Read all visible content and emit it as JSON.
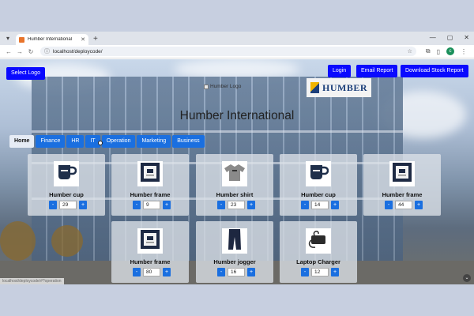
{
  "browser": {
    "tab_title": "Humber International",
    "url": "localhost/deploycode/"
  },
  "page": {
    "select_logo_label": "Select Logo",
    "login_label": "Login",
    "email_report_label": "Email Report",
    "download_stock_report_label": "Download Stock Report",
    "logo_alt_text": "Humber Logo",
    "title": "Humber International",
    "wall_sign_text": "HUMBER",
    "status_text": "localhost/deploycode/#?operation",
    "nav_tabs": [
      {
        "label": "Home",
        "active": true
      },
      {
        "label": "Finance"
      },
      {
        "label": "HR"
      },
      {
        "label": "IT"
      },
      {
        "label": "Operation"
      },
      {
        "label": "Marketing"
      },
      {
        "label": "Business"
      }
    ],
    "products": [
      {
        "name": "Humber cup",
        "qty": "29",
        "icon": "mug-icon"
      },
      {
        "name": "Humber frame",
        "qty": "9",
        "icon": "frame-icon"
      },
      {
        "name": "Humber shirt",
        "qty": "23",
        "icon": "shirt-icon"
      },
      {
        "name": "Humber cup",
        "qty": "14",
        "icon": "mug-icon"
      },
      {
        "name": "Humber frame",
        "qty": "44",
        "icon": "frame-icon"
      },
      {
        "name": "Humber frame",
        "qty": "80",
        "icon": "frame-icon"
      },
      {
        "name": "Humber jogger",
        "qty": "16",
        "icon": "jogger-icon"
      },
      {
        "name": "Laptop Charger",
        "qty": "12",
        "icon": "charger-icon"
      }
    ],
    "stepper": {
      "minus": "-",
      "plus": "+"
    }
  },
  "colors": {
    "button_blue": "#0a0aff",
    "tab_blue": "#1a6fe0"
  }
}
